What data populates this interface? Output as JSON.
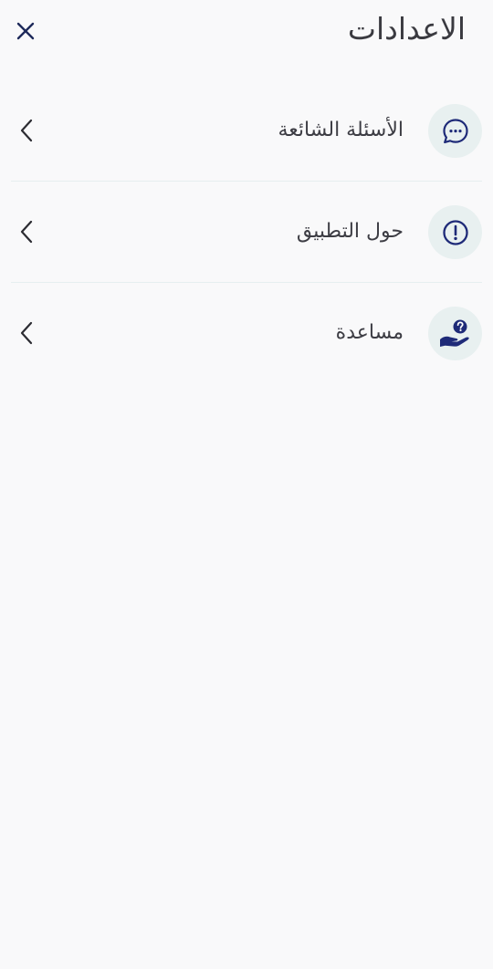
{
  "header": {
    "title": "الاعدادات",
    "close_icon": "close-icon"
  },
  "menu": {
    "items": [
      {
        "label": "الأسئلة الشائعة",
        "icon": "chat-bubble-icon"
      },
      {
        "label": "حول التطبيق",
        "icon": "info-circle-icon"
      },
      {
        "label": "مساعدة",
        "icon": "help-hand-icon"
      }
    ]
  },
  "colors": {
    "background": "#f9f9fa",
    "icon_circle": "#e8f0f0",
    "icon_accent": "#1e2a78",
    "text": "#3a3a40",
    "divider": "#e6eff0"
  }
}
